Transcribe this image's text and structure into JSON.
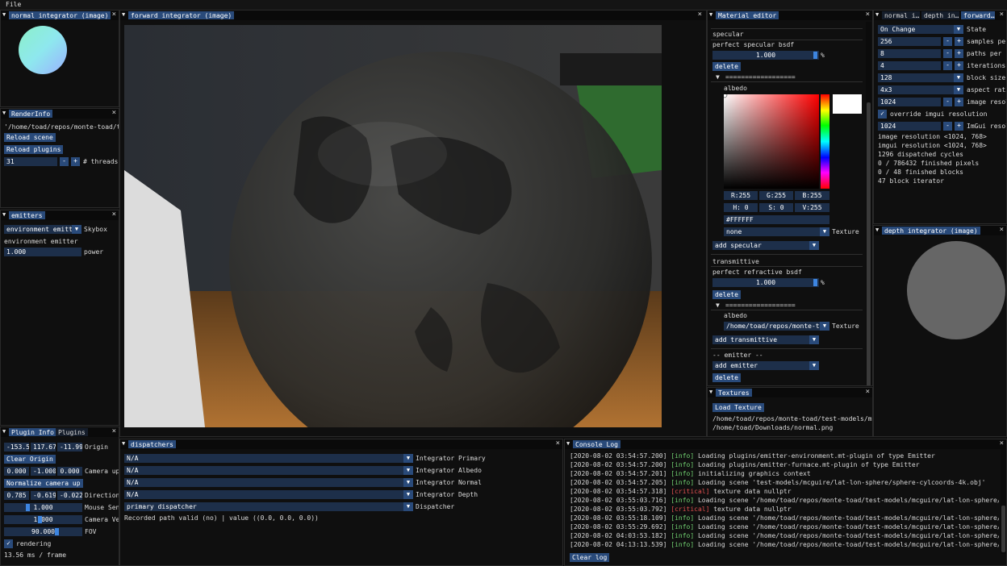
{
  "menu": {
    "file": "File"
  },
  "normal_window": {
    "title": "normal integrator (image)"
  },
  "forward_window": {
    "title": "forward integrator (image)"
  },
  "render_info": {
    "title": "RenderInfo",
    "path": "'/home/toad/repos/monte-toad/te",
    "reload_scene": "Reload scene",
    "reload_plugins": "Reload plugins",
    "threads_value": "31",
    "minus": "-",
    "plus": "+",
    "threads_label": "# threads"
  },
  "emitters": {
    "title": "emitters",
    "combo_value": "environment emitte",
    "combo_label": "Skybox",
    "heading": "environment emitter",
    "power_value": "1.000",
    "power_label": "power"
  },
  "material_editor": {
    "title": "Material editor",
    "specular_heading": "specular",
    "specular_bsdf": "perfect specular bsdf",
    "specular_value": "1.000",
    "percent": "%",
    "delete": "delete",
    "divider": "==================",
    "albedo": "albedo",
    "r": "R:255",
    "g": "G:255",
    "b": "B:255",
    "h": "H:  0",
    "s": "S:  0",
    "v": "V:255",
    "hex": "#FFFFFF",
    "texture_combo": "none",
    "texture_label": "Texture",
    "add_specular": "add specular",
    "transmittive_heading": "transmittive",
    "refractive_bsdf": "perfect refractive bsdf",
    "refractive_value": "1.000",
    "albedo_path": "/home/toad/repos/monte-toa",
    "add_transmittive": "add transmittive",
    "emitter_heading": "-- emitter --",
    "add_emitter": "add emitter"
  },
  "textures": {
    "title": "Textures",
    "load_button": "Load Texture",
    "paths": [
      "/home/toad/repos/monte-toad/test-models/mcg",
      "/home/toad/Downloads/normal.png"
    ]
  },
  "settings": {
    "tabs": [
      "normal i…",
      "depth in…",
      "forward…"
    ],
    "state_value": "On Change",
    "state_label": "State",
    "samples_value": "256",
    "samples_label": "samples per",
    "paths_value": "8",
    "paths_label": "paths per",
    "iterations_value": "4",
    "iterations_label": "iterations",
    "block_value": "128",
    "block_label": "block size",
    "aspect_value": "4x3",
    "aspect_label": "aspect rati",
    "imgres_value": "1024",
    "imgres_label": "image resol",
    "override_label": "override imgui resolution",
    "imgui_value": "1024",
    "imgui_label": "ImGui resol",
    "stats": [
      "image resolution <1024, 768>",
      "imgui resolution <1024, 768>",
      "1296 dispatched cycles",
      "0 / 786432 finished pixels",
      "0 / 48 finished blocks",
      "47 block iterator"
    ]
  },
  "depth_window": {
    "title": "depth integrator (image)"
  },
  "plugin_info": {
    "tabs": [
      "Plugin Info",
      "Plugins"
    ],
    "origin_vals": [
      "-153.5",
      "117.67",
      "-11.99"
    ],
    "origin_label": "Origin",
    "clear_origin": "Clear Origin",
    "camup_vals": [
      "0.000",
      "-1.000",
      "0.000"
    ],
    "camup_label": "Camera up",
    "normalize": "Normalize camera up",
    "dir_vals": [
      "0.785",
      "-0.619",
      "-0.022"
    ],
    "dir_label": "Direction",
    "mouse_value": "1.000",
    "mouse_label": "Mouse Sen",
    "camvel_value": "1.000",
    "camvel_label": "Camera Ve",
    "fov_value": "90.000",
    "fov_label": "FOV",
    "rendering_label": "rendering",
    "frame_time": "13.56 ms / frame"
  },
  "dispatchers": {
    "title": "dispatchers",
    "rows": [
      {
        "value": "N/A",
        "label": "Integrator Primary"
      },
      {
        "value": "N/A",
        "label": "Integrator Albedo"
      },
      {
        "value": "N/A",
        "label": "Integrator Normal"
      },
      {
        "value": "N/A",
        "label": "Integrator Depth"
      },
      {
        "value": "primary dispatcher",
        "label": "Dispatcher"
      }
    ],
    "path_status": "Recorded path valid (no) | value ((0.0, 0.0, 0.0))"
  },
  "console": {
    "title": "Console Log",
    "lines": [
      {
        "ts": "[2020-08-02 03:54:57.200]",
        "level": "[info]",
        "msg": " Loading plugins/emitter-environment.mt-plugin of type Emitter"
      },
      {
        "ts": "[2020-08-02 03:54:57.200]",
        "level": "[info]",
        "msg": " Loading plugins/emitter-furnace.mt-plugin of type Emitter"
      },
      {
        "ts": "[2020-08-02 03:54:57.201]",
        "level": "[info]",
        "msg": " initializing graphics context"
      },
      {
        "ts": "[2020-08-02 03:54:57.205]",
        "level": "[info]",
        "msg": " Loading scene 'test-models/mcguire/lat-lon-sphere/sphere-cylcoords-4k.obj'"
      },
      {
        "ts": "[2020-08-02 03:54:57.318]",
        "level": "[critical]",
        "msg": " texture data nullptr"
      },
      {
        "ts": "[2020-08-02 03:55:03.716]",
        "level": "[info]",
        "msg": " Loading scene '/home/toad/repos/monte-toad/test-models/mcguire/lat-lon-sphere/sphere"
      },
      {
        "ts": "[2020-08-02 03:55:03.792]",
        "level": "[critical]",
        "msg": " texture data nullptr"
      },
      {
        "ts": "[2020-08-02 03:55:18.109]",
        "level": "[info]",
        "msg": " Loading scene '/home/toad/repos/monte-toad/test-models/mcguire/lat-lon-sphere/sphere"
      },
      {
        "ts": "[2020-08-02 03:55:29.692]",
        "level": "[info]",
        "msg": " Loading scene '/home/toad/repos/monte-toad/test-models/mcguire/lat-lon-sphere/sphere"
      },
      {
        "ts": "[2020-08-02 04:03:53.182]",
        "level": "[info]",
        "msg": " Loading scene '/home/toad/repos/monte-toad/test-models/mcguire/lat-lon-sphere/sphere"
      },
      {
        "ts": "[2020-08-02 04:13:13.539]",
        "level": "[info]",
        "msg": " Loading scene '/home/toad/repos/monte-toad/test-models/mcguire/lat-lon-sphere/sphere"
      }
    ],
    "clear_log": "Clear log"
  }
}
